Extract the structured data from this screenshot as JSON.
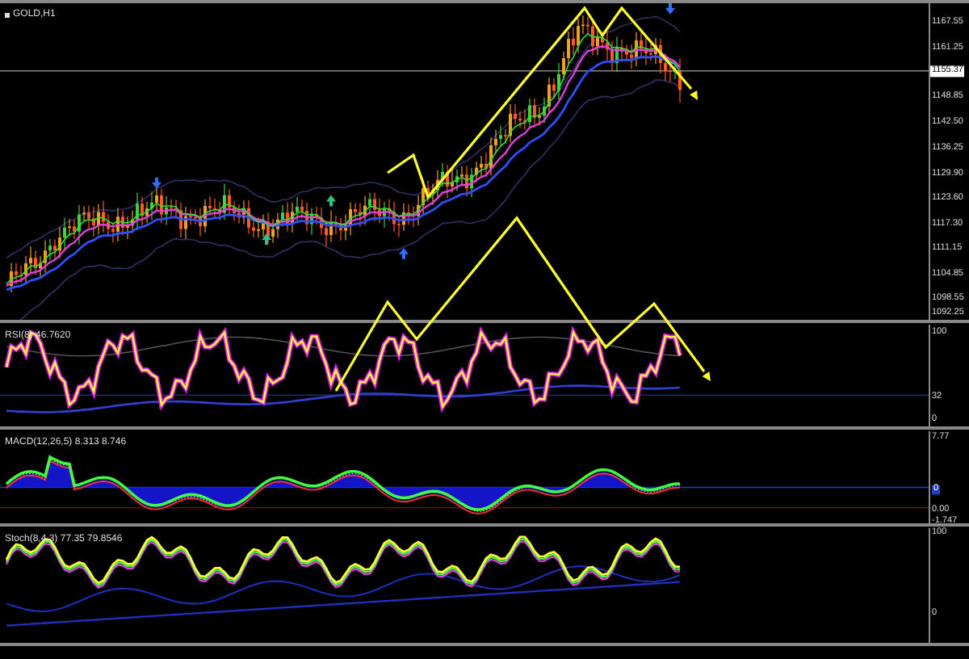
{
  "chart": {
    "symbol": "GOLD,H1",
    "current_price": "1155.37",
    "price_ticks": [
      "1167.55",
      "1161.25",
      "1148.85",
      "1142.50",
      "1136.25",
      "1129.90",
      "1123.60",
      "1117.30",
      "1111.15",
      "1104.85",
      "1098.55",
      "1092.25"
    ]
  },
  "indicators": [
    {
      "kind": "rsi",
      "label": "RSI(8) 46.7620",
      "ticks": [
        "100",
        "32",
        "0"
      ]
    },
    {
      "kind": "macd",
      "label": "MACD(12,26,5) 8.313 8.746",
      "ticks": [
        "7.77",
        "0",
        "0.00",
        "-1.747"
      ]
    },
    {
      "kind": "stochastic",
      "label": "Stoch(8,4,3) 77.35 79.8546",
      "ticks": [
        "100",
        "0"
      ]
    }
  ]
}
